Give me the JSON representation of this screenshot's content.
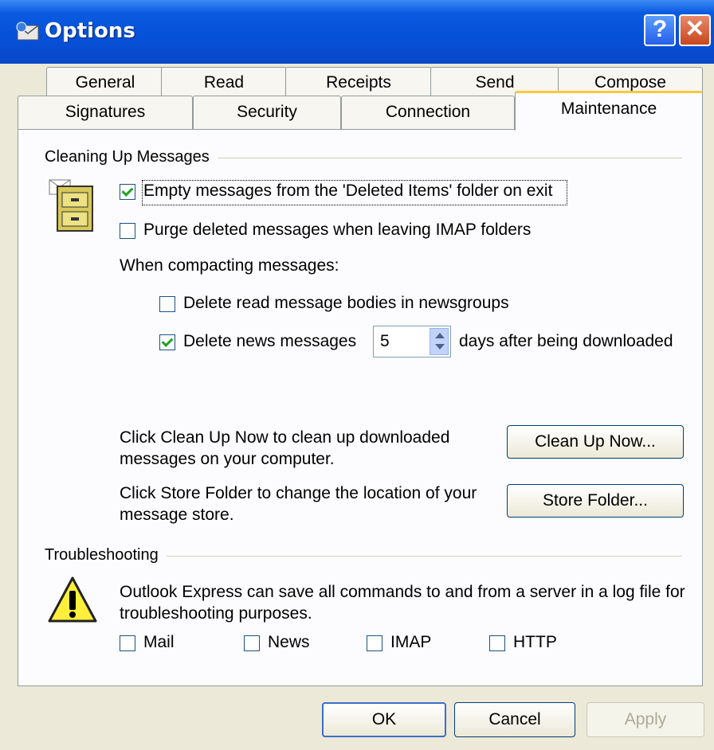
{
  "window": {
    "title": "Options",
    "help_label": "?",
    "close_label": "✕"
  },
  "tabs_row1": [
    "General",
    "Read",
    "Receipts",
    "Send",
    "Compose"
  ],
  "tabs_row2": [
    "Signatures",
    "Security",
    "Connection",
    "Maintenance"
  ],
  "active_tab": "Maintenance",
  "cleaning": {
    "group_label": "Cleaning Up Messages",
    "empty_deleted": {
      "label": "Empty messages from the 'Deleted Items' folder on exit",
      "checked": true
    },
    "purge_imap": {
      "label": "Purge deleted messages when leaving IMAP folders",
      "checked": false
    },
    "compacting_label": "When compacting messages:",
    "delete_bodies": {
      "label": "Delete read message bodies in newsgroups",
      "checked": false
    },
    "delete_news": {
      "label": "Delete news messages",
      "checked": true,
      "days_value": "5",
      "suffix": "days after being downloaded"
    },
    "cleanup_text": "Click Clean Up Now to clean up downloaded messages on your computer.",
    "cleanup_button": "Clean Up Now...",
    "store_text": "Click Store Folder to change the location of your message store.",
    "store_button": "Store Folder..."
  },
  "troubleshooting": {
    "group_label": "Troubleshooting",
    "description": "Outlook Express can save all commands to and from a server in a log file for troubleshooting purposes.",
    "options": [
      {
        "label": "Mail",
        "checked": false
      },
      {
        "label": "News",
        "checked": false
      },
      {
        "label": "IMAP",
        "checked": false
      },
      {
        "label": "HTTP",
        "checked": false
      }
    ]
  },
  "footer": {
    "ok": "OK",
    "cancel": "Cancel",
    "apply": "Apply",
    "apply_enabled": false
  },
  "colors": {
    "titlebar": "#0a5ae0",
    "dialog_bg": "#ece9d8",
    "panel_bg": "#fcfcfe",
    "active_tab_accent": "#ffc83c",
    "check_green": "#21a121"
  },
  "icons": {
    "title": "outlook-express-icon",
    "cleaning": "filing-cabinet-icon",
    "troubleshooting": "warning-icon"
  }
}
